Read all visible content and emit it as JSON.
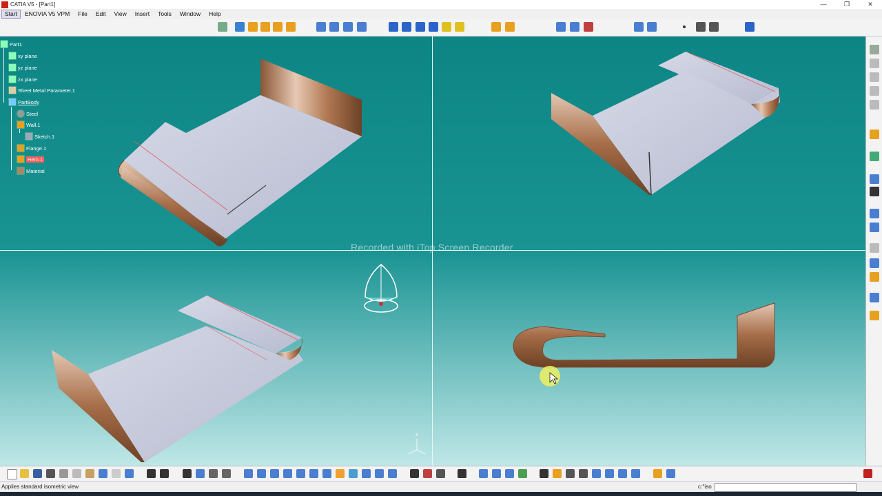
{
  "window": {
    "title": "CATIA V5 - [Part1]",
    "minimize": "—",
    "restore": "❐",
    "close": "✕"
  },
  "menu": {
    "items": [
      "Start",
      "ENOVIA V5 VPM",
      "File",
      "Edit",
      "View",
      "Insert",
      "Tools",
      "Window",
      "Help"
    ]
  },
  "tree": {
    "nodes": [
      {
        "label": "Part1",
        "icon": "part-icon"
      },
      {
        "label": "xy plane",
        "icon": "plane-icon"
      },
      {
        "label": "yz plane",
        "icon": "plane-icon"
      },
      {
        "label": "zx plane",
        "icon": "plane-icon"
      },
      {
        "label": "Sheet Metal Parameter.1",
        "icon": "sheet-metal-parameters-icon"
      },
      {
        "label": "PartBody",
        "icon": "body-icon"
      },
      {
        "label": "Steel",
        "icon": "material-sphere-icon"
      },
      {
        "label": "Wall.1",
        "icon": "wall-icon"
      },
      {
        "label": "Sketch.1",
        "icon": "sketch-icon"
      },
      {
        "label": "Flange.1",
        "icon": "flange-icon"
      },
      {
        "label": "Hem.1",
        "icon": "hem-icon"
      },
      {
        "label": "Material",
        "icon": "material-icon"
      }
    ]
  },
  "viewport": {
    "watermark": "Recorded with iTop Screen Recorder",
    "layout": "four-views",
    "background": "#1a8f8f"
  },
  "compass_label": "z",
  "status": {
    "text": "Applies standard isometric view",
    "command_label": "c:°iso",
    "command_value": ""
  },
  "colors": {
    "titlebar": "#ffffff",
    "menubar": "#f0f0f0",
    "toolbar": "#f3f3f3",
    "sheet_metal": "#c9cde0",
    "bend": "#b27a54",
    "highlight": "#f06060"
  }
}
